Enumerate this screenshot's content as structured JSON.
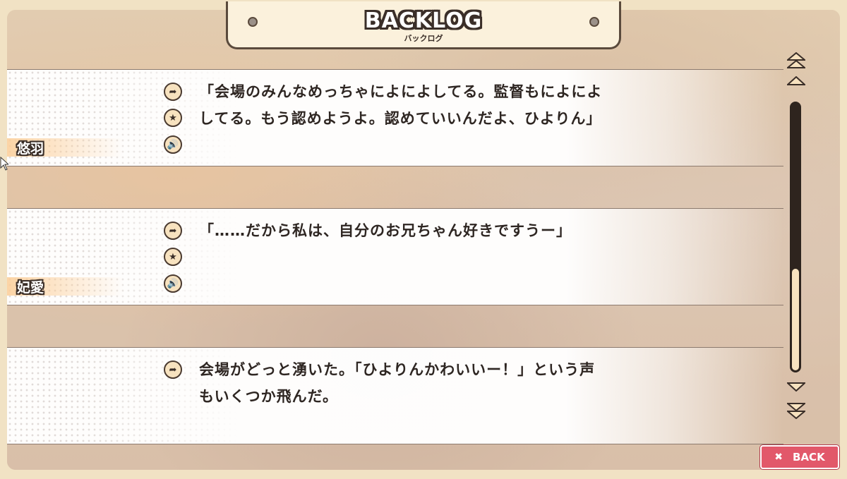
{
  "screen": {
    "title": "BACKLOG",
    "subtitle": "バックログ"
  },
  "entries": [
    {
      "speaker": "悠羽",
      "lines": [
        "「会場のみんなめっちゃによによしてる。監督もによによ",
        "してる。もう認めようよ。認めていいんだよ、ひよりん」"
      ],
      "icons": [
        "jump-icon",
        "favorite-star-icon",
        "voice-replay-icon"
      ]
    },
    {
      "speaker": "妃愛",
      "lines": [
        "「……だから私は、自分のお兄ちゃん好きですうー」"
      ],
      "icons": [
        "jump-icon",
        "favorite-star-icon",
        "voice-replay-icon"
      ]
    },
    {
      "speaker": "",
      "lines": [
        "会場がどっと湧いた。「ひよりんかわいいー！」という声",
        "もいくつか飛んだ。"
      ],
      "icons": [
        "jump-icon"
      ]
    }
  ],
  "scrollbar": {
    "position_fraction": 1.0,
    "visible_fraction": 0.38
  },
  "back_button": {
    "label": "BACK",
    "icon": "close-x-icon"
  },
  "colors": {
    "accent_back": "#e2586a",
    "panel_bg": "#fbf1dc",
    "outline": "#3a2e28"
  }
}
